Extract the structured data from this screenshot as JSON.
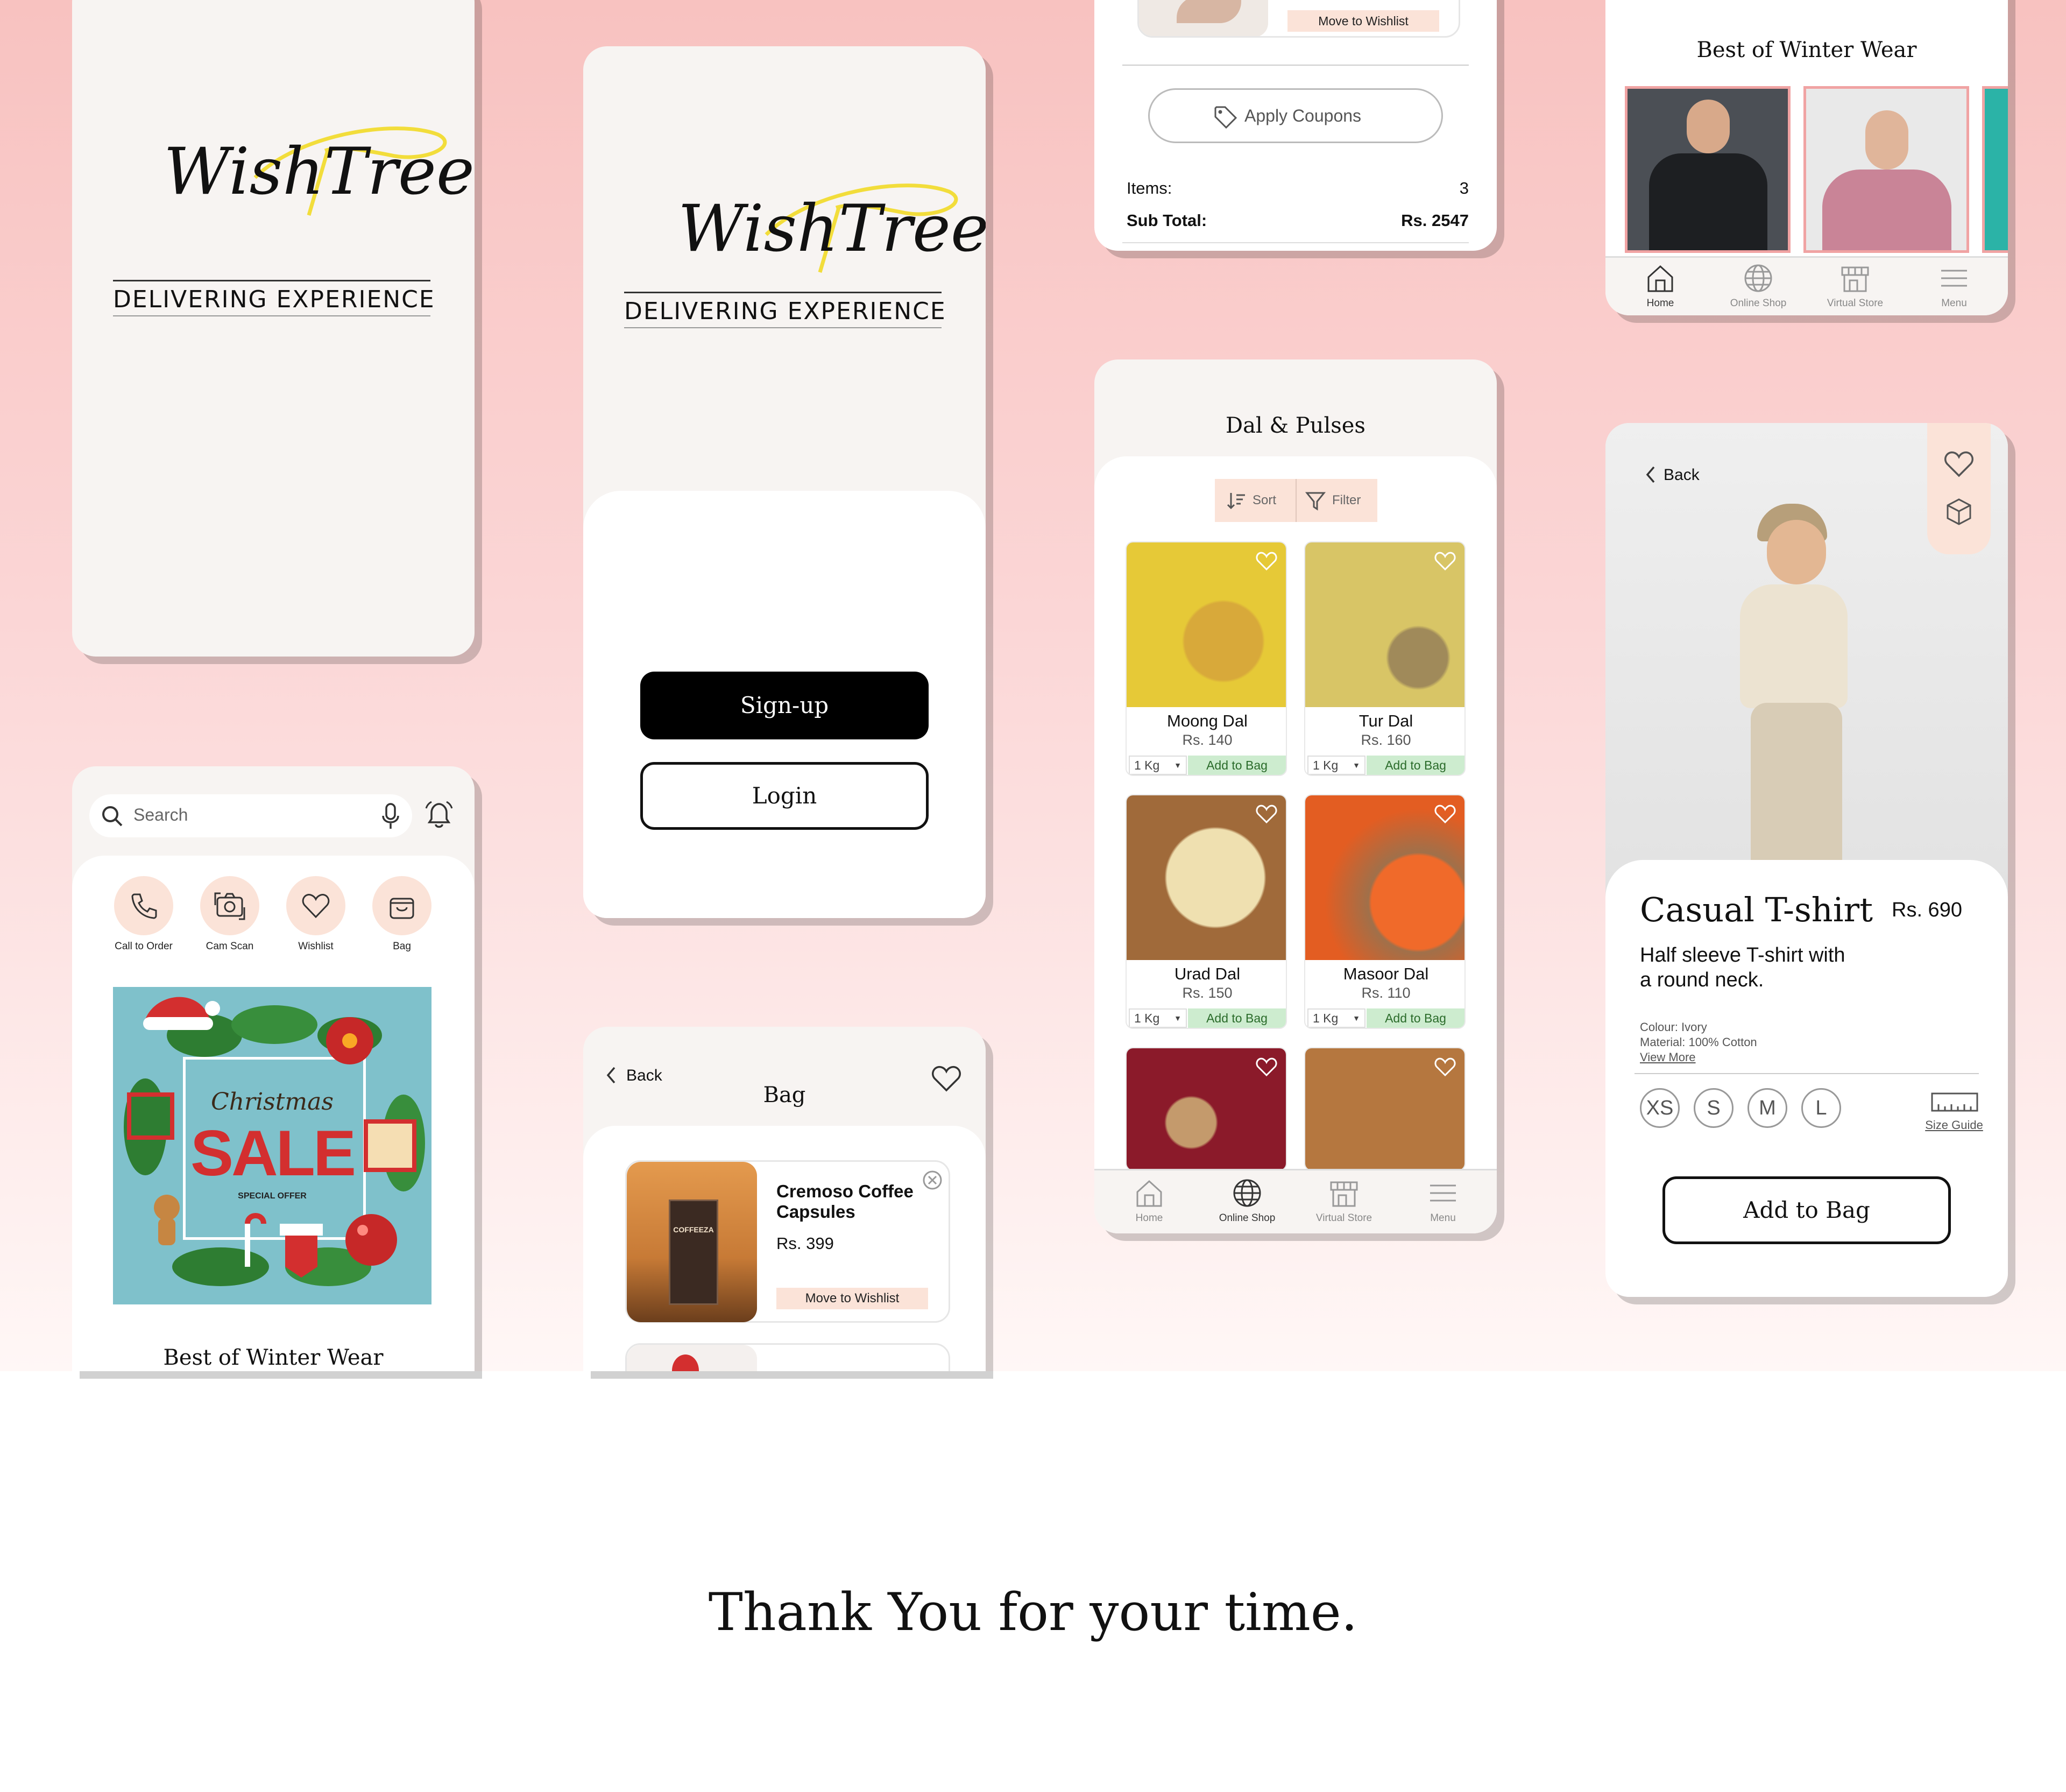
{
  "brand": {
    "logo_text": "WishTree",
    "tagline": "DELIVERING EXPERIENCE"
  },
  "auth": {
    "signup_label": "Sign-up",
    "login_label": "Login"
  },
  "home": {
    "search_placeholder": "Search",
    "quick_actions": [
      "Call to Order",
      "Cam Scan",
      "Wishlist",
      "Bag"
    ],
    "banner": {
      "line1": "Christmas",
      "line2": "SALE",
      "line3": "SPECIAL OFFER"
    },
    "section_title": "Best of Winter Wear"
  },
  "bag": {
    "back_label": "Back",
    "title": "Bag",
    "item": {
      "name_line1": "Cremoso Coffee",
      "name_line2": "Capsules",
      "price": "Rs. 399",
      "product_label": "COFFEEZA",
      "move_label": "Move to Wishlist"
    }
  },
  "checkout": {
    "move_label": "Move to Wishlist",
    "apply_coupons": "Apply Coupons",
    "items_label": "Items:",
    "items_value": "3",
    "subtotal_label": "Sub Total:",
    "subtotal_value": "Rs. 2547"
  },
  "category": {
    "title": "Dal & Pulses",
    "sort_label": "Sort",
    "filter_label": "Filter",
    "products": [
      {
        "name": "Moong Dal",
        "price": "Rs. 140",
        "qty": "1 Kg",
        "add": "Add to Bag"
      },
      {
        "name": "Tur Dal",
        "price": "Rs. 160",
        "qty": "1 Kg",
        "add": "Add to Bag"
      },
      {
        "name": "Urad Dal",
        "price": "Rs. 150",
        "qty": "1 Kg",
        "add": "Add to Bag"
      },
      {
        "name": "Masoor Dal",
        "price": "Rs. 110",
        "qty": "1 Kg",
        "add": "Add to Bag"
      }
    ],
    "nav": [
      "Home",
      "Online Shop",
      "Virtual Store",
      "Menu"
    ]
  },
  "winter": {
    "title": "Best of Winter Wear",
    "nav": [
      "Home",
      "Online Shop",
      "Virtual Store",
      "Menu"
    ]
  },
  "detail": {
    "back_label": "Back",
    "name": "Casual T-shirt",
    "price": "Rs. 690",
    "desc_line1": "Half sleeve T-shirt with",
    "desc_line2": "a round neck.",
    "colour": "Colour: Ivory",
    "material": "Material: 100% Cotton",
    "view_more": "View More",
    "sizes": [
      "XS",
      "S",
      "M",
      "L"
    ],
    "size_guide": "Size Guide",
    "add_to_bag": "Add to Bag"
  },
  "footer": {
    "thanks": "Thank You for your time."
  },
  "colors": {
    "accent_pink": "#f8c2c0",
    "logo_yellow": "#f2dd3b",
    "add_green": "#cdeccf",
    "peach": "#fbe3d8"
  }
}
